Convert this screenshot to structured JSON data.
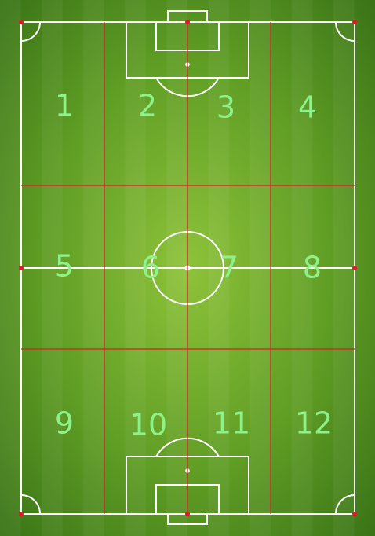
{
  "colors": {
    "grass_dark": "#3a7417",
    "grass_light": "#8ec33a",
    "stripe": "#ffffff",
    "pitch_line": "#ffffff",
    "grid_line": "#e0182a",
    "label": "#8ef28a"
  },
  "zones": [
    {
      "number": "1"
    },
    {
      "number": "2"
    },
    {
      "number": "3"
    },
    {
      "number": "4"
    },
    {
      "number": "5"
    },
    {
      "number": "6"
    },
    {
      "number": "7"
    },
    {
      "number": "8"
    },
    {
      "number": "9"
    },
    {
      "number": "10"
    },
    {
      "number": "11"
    },
    {
      "number": "12"
    }
  ]
}
